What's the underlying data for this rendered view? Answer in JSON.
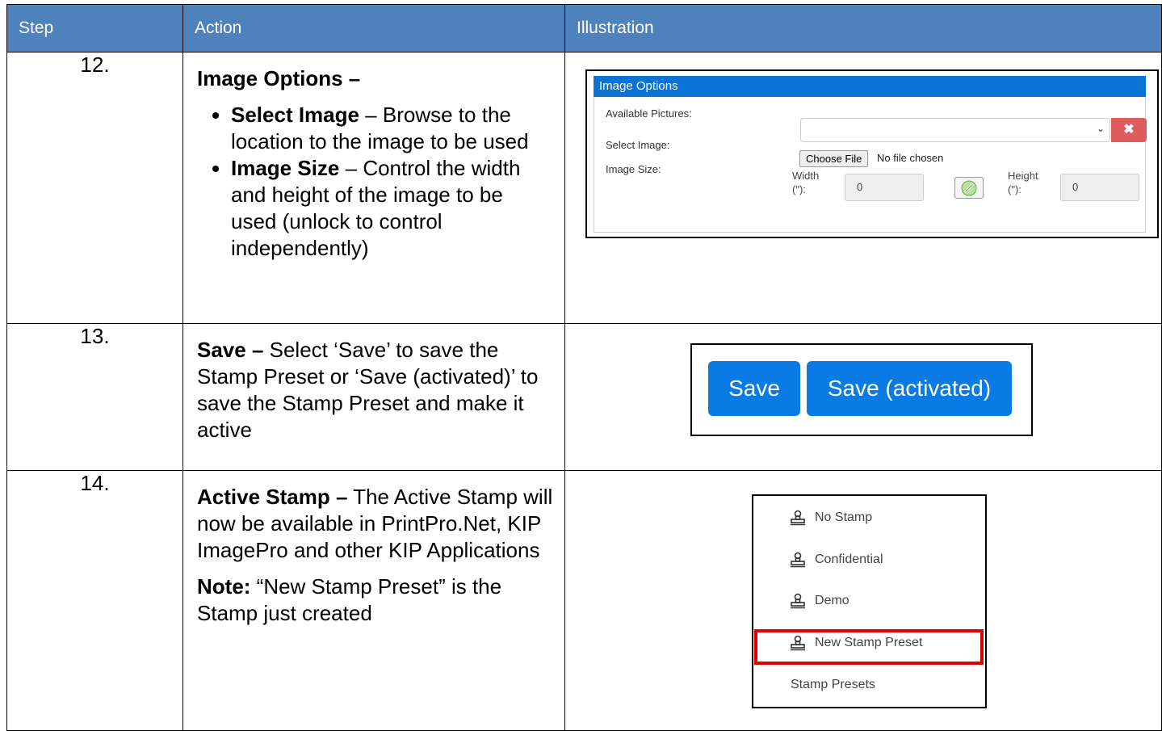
{
  "header": {
    "step": "Step",
    "action": "Action",
    "illustration": "Illustration"
  },
  "rows": [
    {
      "step": "12.",
      "title": "Image Options –",
      "bullets": [
        {
          "bold": "Select Image",
          "text": " – Browse to the location to the image to be used"
        },
        {
          "bold": "Image Size",
          "text": " – Control the width and height of the image to be used (unlock to control independently)"
        }
      ]
    },
    {
      "step": "13.",
      "bold": "Save –",
      "text": " Select ‘Save’ to save the Stamp Preset or ‘Save (activated)’ to save the Stamp Preset and make it active"
    },
    {
      "step": "14.",
      "bold": "Active Stamp –",
      "text": " The Active Stamp will now be available in PrintPro.Net, KIP ImagePro and other KIP Applications",
      "note_bold": "Note:",
      "note_text": " “New Stamp Preset” is the Stamp just created"
    }
  ],
  "image_options": {
    "title": "Image Options",
    "available_pictures_label": "Available Pictures:",
    "select_image_label": "Select Image:",
    "image_size_label": "Image Size:",
    "choose_file": "Choose File",
    "no_file": "No file chosen",
    "width_label": "Width",
    "width_unit": "(\"):",
    "width_value": "0",
    "height_label": "Height",
    "height_unit": "(\"):",
    "height_value": "0",
    "clear_icon": "close-icon",
    "link_icon": "link-icon"
  },
  "save_panel": {
    "save": "Save",
    "save_activated": "Save (activated)"
  },
  "stamp_menu": {
    "items": [
      "No Stamp",
      "Confidential",
      "Demo",
      "New Stamp Preset"
    ],
    "footer": "Stamp Presets",
    "highlight_color": "#e10000"
  },
  "colors": {
    "header_bg": "#4f81bd",
    "panel_head": "#0b73d4",
    "button": "#0a7be4",
    "danger": "#e05d5f"
  }
}
